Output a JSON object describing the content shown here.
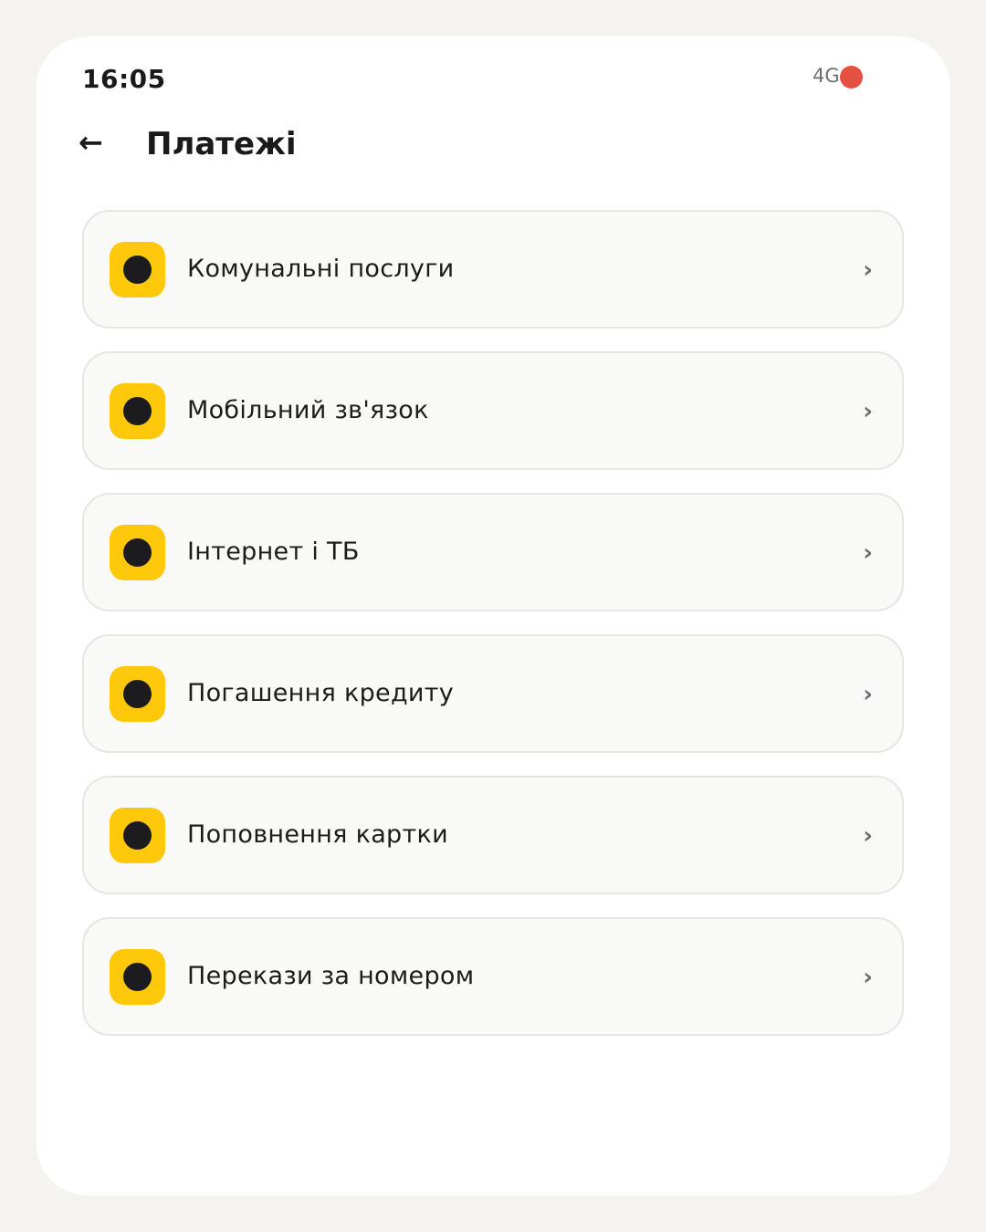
{
  "status_bar": {
    "time": "16:05",
    "network": "4G",
    "indicator_color": "#e55140"
  },
  "header": {
    "back_icon": "←",
    "title": "Платежі"
  },
  "colors": {
    "accent": "#ffc80a",
    "icon_dot": "#1c1c1f"
  },
  "payments": {
    "chevron": "›",
    "items": [
      {
        "label": "Комунальні послуги",
        "icon": "circle-icon"
      },
      {
        "label": "Мобільний зв'язок",
        "icon": "circle-icon"
      },
      {
        "label": "Інтернет і ТБ",
        "icon": "circle-icon"
      },
      {
        "label": "Погашення кредиту",
        "icon": "circle-icon"
      },
      {
        "label": "Поповнення картки",
        "icon": "circle-icon"
      },
      {
        "label": "Перекази за номером",
        "icon": "circle-icon"
      }
    ]
  }
}
